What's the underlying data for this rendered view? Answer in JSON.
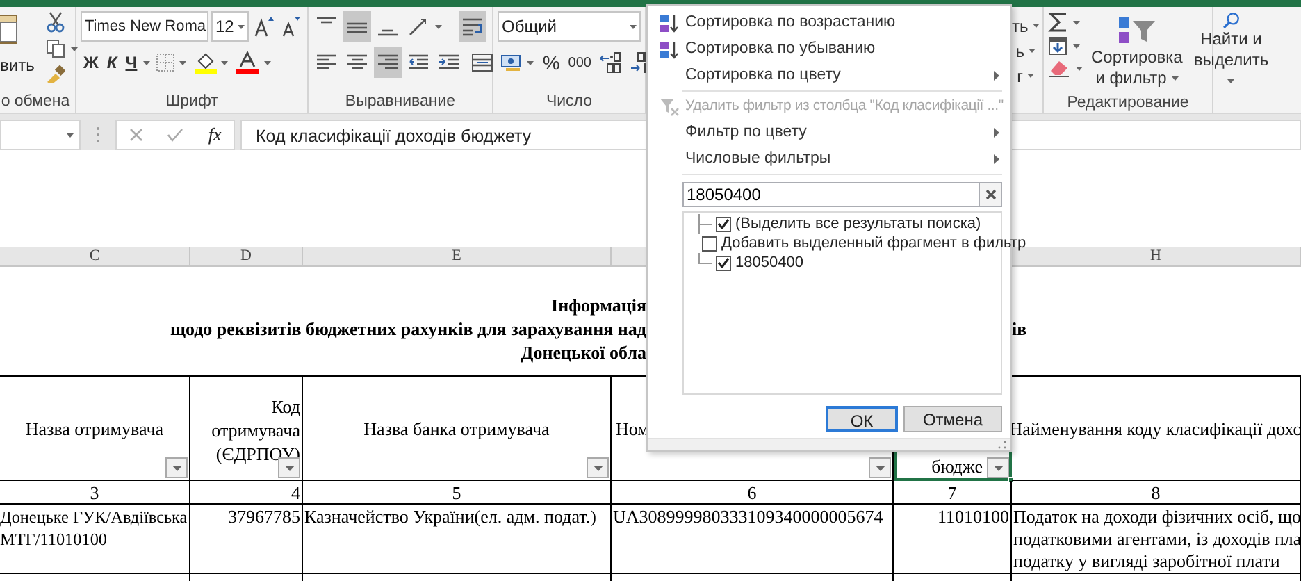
{
  "ribbon": {
    "groups": [
      {
        "kind": "clipboard",
        "label": "о обмена",
        "paste_label": "вить"
      },
      {
        "kind": "font",
        "label": "Шрифт",
        "font_name": "Times New Roma",
        "font_size": "12",
        "bold": "Ж",
        "italic": "К",
        "underline": "Ч"
      },
      {
        "kind": "alignment",
        "label": "Выравнивание",
        "buttons": [
          {
            "kind": "top",
            "selected": false
          },
          {
            "kind": "middle",
            "selected": true
          },
          {
            "kind": "bottom",
            "selected": false
          },
          {
            "kind": "orientation",
            "selected": false
          },
          {
            "kind": "wrap",
            "selected": true
          },
          {
            "kind": "left",
            "selected": false
          },
          {
            "kind": "center",
            "selected": false
          },
          {
            "kind": "right",
            "selected": true
          },
          {
            "kind": "outdent",
            "selected": false
          },
          {
            "kind": "indent",
            "selected": false
          },
          {
            "kind": "merge",
            "selected": false
          }
        ]
      },
      {
        "kind": "number",
        "label": "Число",
        "format": "Общий",
        "percent": "%",
        "thousands": "000"
      },
      {
        "kind": "cells",
        "items": [
          "ть",
          "ь",
          "г"
        ]
      },
      {
        "kind": "editing",
        "label": "Редактирование",
        "sort_filter": [
          "Сортировка",
          "и фильтр"
        ],
        "find": [
          "Найти и",
          "выделить"
        ]
      }
    ]
  },
  "formula_bar": {
    "fx": "fx",
    "content": "Код класифікації доходів бюджету"
  },
  "sheet": {
    "columns": [
      {
        "letter": "C"
      },
      {
        "letter": "D"
      },
      {
        "letter": "E"
      },
      {},
      {},
      {
        "letter": "H"
      }
    ],
    "title_lines": [
      {
        "left": "Інформація"
      },
      {
        "left": "щодо реквізитів бюджетних рахунків для зарахування над",
        "right": "ів"
      },
      {
        "left": "Донецької обла"
      }
    ],
    "header": [
      {
        "text": "Назва отримувача",
        "filter": true,
        "selected": false
      },
      {
        "text": "Код отримувача (ЄДРПОУ)",
        "filter": true,
        "selected": false
      },
      {
        "text": "Назва банка отримувача",
        "filter": true,
        "selected": false
      },
      {
        "text": "Ном",
        "filter": true,
        "selected": false
      },
      {
        "text": "бюдже",
        "filter": true,
        "selected": true
      },
      {
        "text": "Найменування коду класифікації дохо",
        "filter": false,
        "selected": false
      }
    ],
    "numbers": [
      "3",
      "4",
      "5",
      "6",
      "7",
      "8"
    ],
    "rows": [
      {
        "cells": [
          [
            "Донецьке ГУК/Авдіївська",
            "МТГ/11010100"
          ],
          [
            "37967785"
          ],
          [
            "Казначейство України(ел. адм. подат.)"
          ],
          [
            "UA308999980333109340000005674"
          ],
          [
            "11010100"
          ],
          [
            "Податок на доходи фізичних осіб, що",
            "податковими агентами, із доходів пла",
            "податку у вигляді заробітної плати"
          ]
        ]
      }
    ]
  },
  "filter_menu": {
    "items": [
      {
        "kind": "sort_asc",
        "label": "Сортировка по возрастанию",
        "disabled": false,
        "submenu": false
      },
      {
        "kind": "sort_desc",
        "label": "Сортировка по убыванию",
        "disabled": false,
        "submenu": false
      },
      {
        "kind": "plain",
        "label": "Сортировка по цвету",
        "disabled": false,
        "submenu": true
      },
      {
        "kind": "separator"
      },
      {
        "kind": "clear_filter",
        "label": "Удалить фильтр из столбца \"Код класифікації ...\"",
        "disabled": true,
        "submenu": false
      },
      {
        "kind": "plain",
        "label": "Фильтр по цвету",
        "disabled": false,
        "submenu": true
      },
      {
        "kind": "plain",
        "label": "Числовые фильтры",
        "disabled": false,
        "submenu": true
      },
      {
        "kind": "separator"
      }
    ],
    "search": {
      "value": "18050400"
    },
    "list": [
      {
        "label": "(Выделить все результаты поиска)",
        "checked": true
      },
      {
        "label": "Добавить выделенный фрагмент в фильтр",
        "checked": false
      },
      {
        "label": "18050400",
        "checked": true
      }
    ],
    "buttons": [
      {
        "label": "ОК",
        "default": true
      },
      {
        "label": "Отмена",
        "default": false
      }
    ]
  }
}
